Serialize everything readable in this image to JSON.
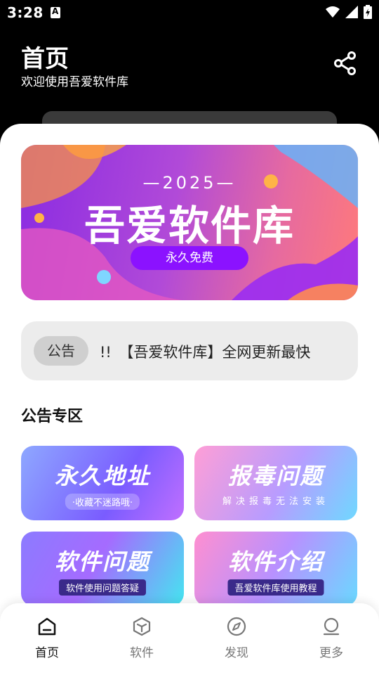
{
  "status_bar": {
    "time": "3:28"
  },
  "header": {
    "title": "首页",
    "subtitle": "欢迎使用吾爱软件库"
  },
  "banner": {
    "year": "—2025—",
    "title": "吾爱软件库",
    "tagline": "永久免费"
  },
  "notice": {
    "tag": "公告",
    "text": "!!　【吾爱软件库】全网更新最快"
  },
  "section": {
    "title": "公告专区"
  },
  "cards": [
    {
      "title": "永久地址",
      "subtitle": "·收藏不迷路哦·"
    },
    {
      "title": "报毒问题",
      "subtitle": "解决报毒无法安装"
    },
    {
      "title": "软件问题",
      "subtitle": "软件使用问题答疑"
    },
    {
      "title": "软件介绍",
      "subtitle": "吾爱软件库使用教程"
    }
  ],
  "bottom_nav": [
    {
      "label": "首页",
      "icon": "home-icon",
      "active": true
    },
    {
      "label": "软件",
      "icon": "cube-icon",
      "active": false
    },
    {
      "label": "发现",
      "icon": "compass-icon",
      "active": false
    },
    {
      "label": "更多",
      "icon": "person-icon",
      "active": false
    }
  ],
  "colors": {
    "accent": "#8b12ff",
    "background": "#000000",
    "sheet": "#ffffff"
  }
}
